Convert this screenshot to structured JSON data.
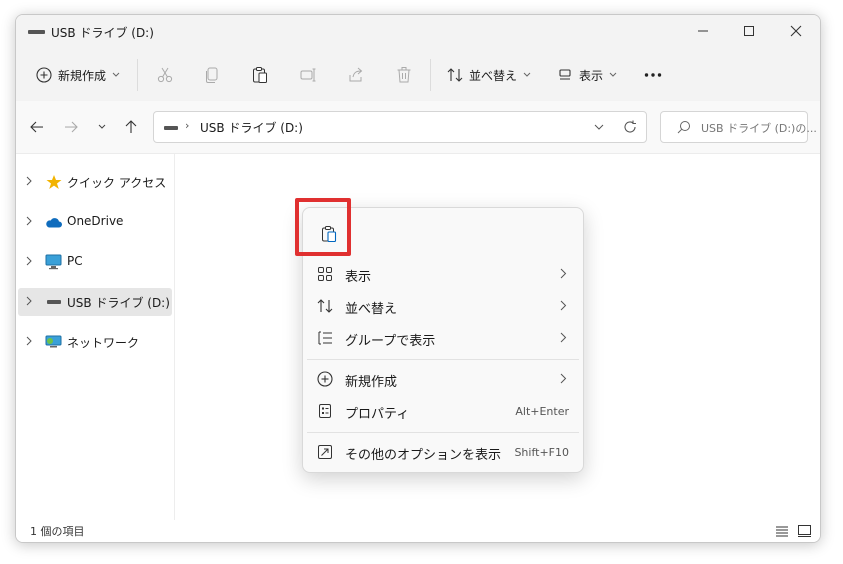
{
  "window": {
    "title": "USB ドライブ (D:)"
  },
  "toolbar": {
    "new_label": "新規作成",
    "sort_label": "並べ替え",
    "view_label": "表示"
  },
  "address": {
    "path": "USB ドライブ (D:)",
    "separator": "›"
  },
  "search": {
    "placeholder": "USB ドライブ (D:)の..."
  },
  "sidebar": {
    "items": [
      {
        "label": "クイック アクセス"
      },
      {
        "label": "OneDrive"
      },
      {
        "label": "PC"
      },
      {
        "label": "USB ドライブ (D:)"
      },
      {
        "label": "ネットワーク"
      }
    ]
  },
  "status": {
    "text": "1 個の項目"
  },
  "context_menu": {
    "items": [
      {
        "label": "表示"
      },
      {
        "label": "並べ替え"
      },
      {
        "label": "グループで表示"
      },
      {
        "label": "新規作成"
      },
      {
        "label": "プロパティ",
        "shortcut": "Alt+Enter"
      },
      {
        "label": "その他のオプションを表示",
        "shortcut": "Shift+F10"
      }
    ]
  },
  "colors": {
    "accent": "#0067c0",
    "highlight": "#e03030",
    "star": "#f2b300",
    "onedrive": "#0f6cbd"
  }
}
